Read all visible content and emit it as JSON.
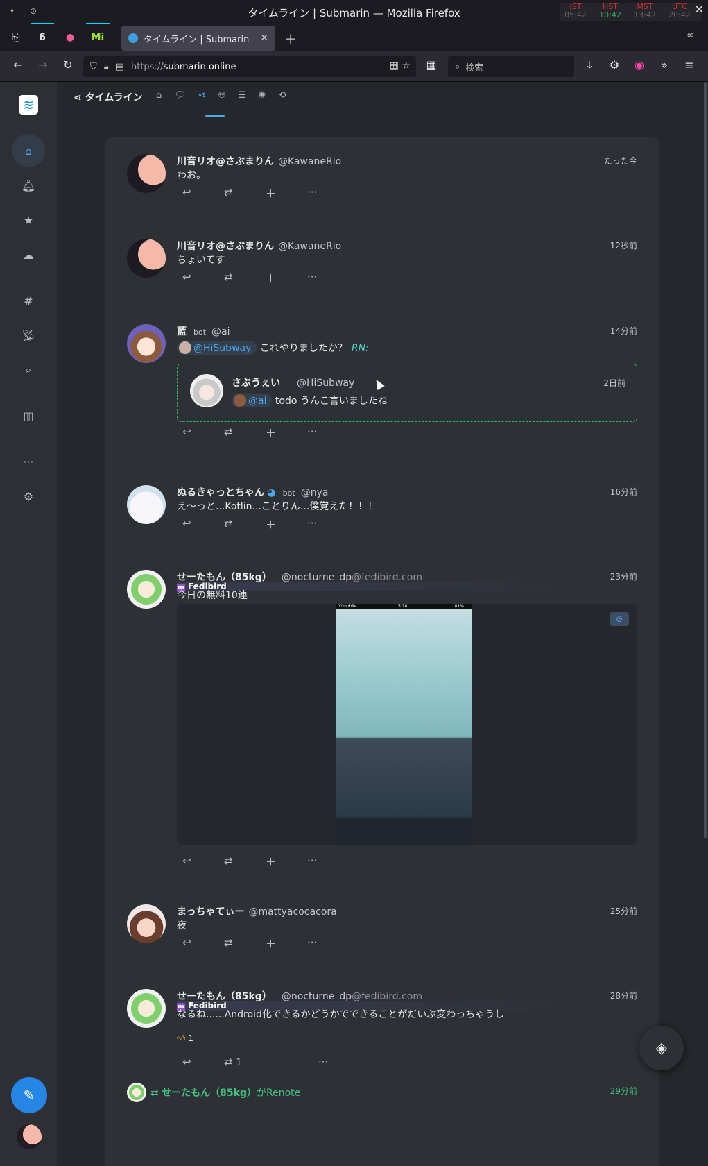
{
  "window": {
    "title": "タイムライン | Submarin — Mozilla Firefox"
  },
  "clock": [
    {
      "zone": "JST",
      "time": "05:42"
    },
    {
      "zone": "HST",
      "time": "10:42"
    },
    {
      "zone": "MST",
      "time": "13:42"
    },
    {
      "zone": "UTC",
      "time": "20:42"
    }
  ],
  "tab": {
    "label": "タイムライン | Submarin"
  },
  "urlbar": {
    "scheme": "https://",
    "host": "submarin.online"
  },
  "searchbar": {
    "placeholder": "検索"
  },
  "topnav": {
    "title": "タイムライン"
  },
  "notes": [
    {
      "name": "川音リオ@さぶまりん",
      "acct": "@KawaneRio",
      "host": "",
      "time": "たった今",
      "text": "わお。"
    },
    {
      "name": "川音リオ@さぶまりん",
      "acct": "@KawaneRio",
      "host": "",
      "time": "12秒前",
      "text": "ちょいてす"
    },
    {
      "name": "藍",
      "bot": "bot",
      "acct": "@ai",
      "host": "",
      "time": "14分前",
      "mention": "@HiSubway",
      "text": "これやりましたか？",
      "rn": "RN:",
      "quote": {
        "name": "さぶうぇい",
        "acct": "@HiSubway",
        "time": "2日前",
        "mention": "@ai",
        "text": "todo うんこ言いましたね"
      }
    },
    {
      "name": "ぬるきゃっとちゃん",
      "bot": "bot",
      "acct": "@nya",
      "host": "",
      "time": "16分前",
      "text": "え～っと...Kotlin...ことりん...僕覚えた！！！"
    },
    {
      "name": "せーたもん（85kg）",
      "acct": "@nocturne_dp",
      "host": "@fedibird.com",
      "time": "23分前",
      "instance": "Fedibird",
      "text": "今日の無料10連"
    },
    {
      "name": "まっちゃてぃー",
      "acct": "@mattyacocacora",
      "host": "",
      "time": "25分前",
      "text": "夜"
    },
    {
      "name": "せーたもん（85kg）",
      "acct": "@nocturne_dp",
      "host": "@fedibird.com",
      "time": "28分前",
      "instance": "Fedibird",
      "text": "なるね......Android化できるかどうかでできることがだいぶ変わっちゃうし",
      "reaction_count": "1",
      "renote_count": "1"
    }
  ],
  "renote_bar": {
    "name": "せーたもん（85kg）",
    "suffix": "がRenote",
    "time": "29分前"
  },
  "phone_status": {
    "carrier": "Y!mobile",
    "time": "5:18",
    "battery": "81%"
  },
  "colors": {
    "accent": "#4aa7f0",
    "renote": "#43c07f",
    "quote_border": "#2bbf6a"
  }
}
